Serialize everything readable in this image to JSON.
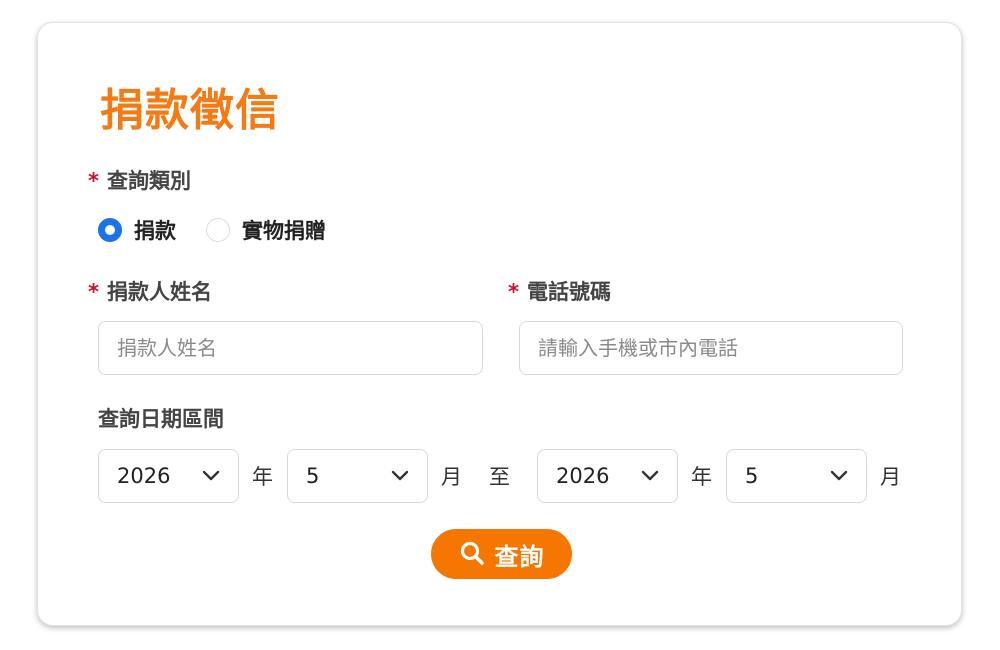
{
  "form": {
    "title": "捐款徵信",
    "category": {
      "label": "查詢類別",
      "required_mark": "*",
      "options": [
        {
          "label": "捐款",
          "checked": true
        },
        {
          "label": "實物捐贈",
          "checked": false
        }
      ]
    },
    "donor_name": {
      "label": "捐款人姓名",
      "required_mark": "*",
      "placeholder": "捐款人姓名",
      "value": ""
    },
    "phone": {
      "label": "電話號碼",
      "required_mark": "*",
      "placeholder": "請輸入手機或市內電話",
      "value": ""
    },
    "date_range": {
      "label": "查詢日期區間",
      "start_year": "2026",
      "start_month": "5",
      "end_year": "2026",
      "end_month": "5",
      "year_unit": "年",
      "month_unit": "月",
      "to_text": "至"
    },
    "submit": {
      "label": "查詢",
      "icon": "search-icon"
    }
  },
  "colors": {
    "accent": "#f47b13",
    "button": "#f57600",
    "required": "#c8102e",
    "radio_checked": "#1a73e8"
  }
}
